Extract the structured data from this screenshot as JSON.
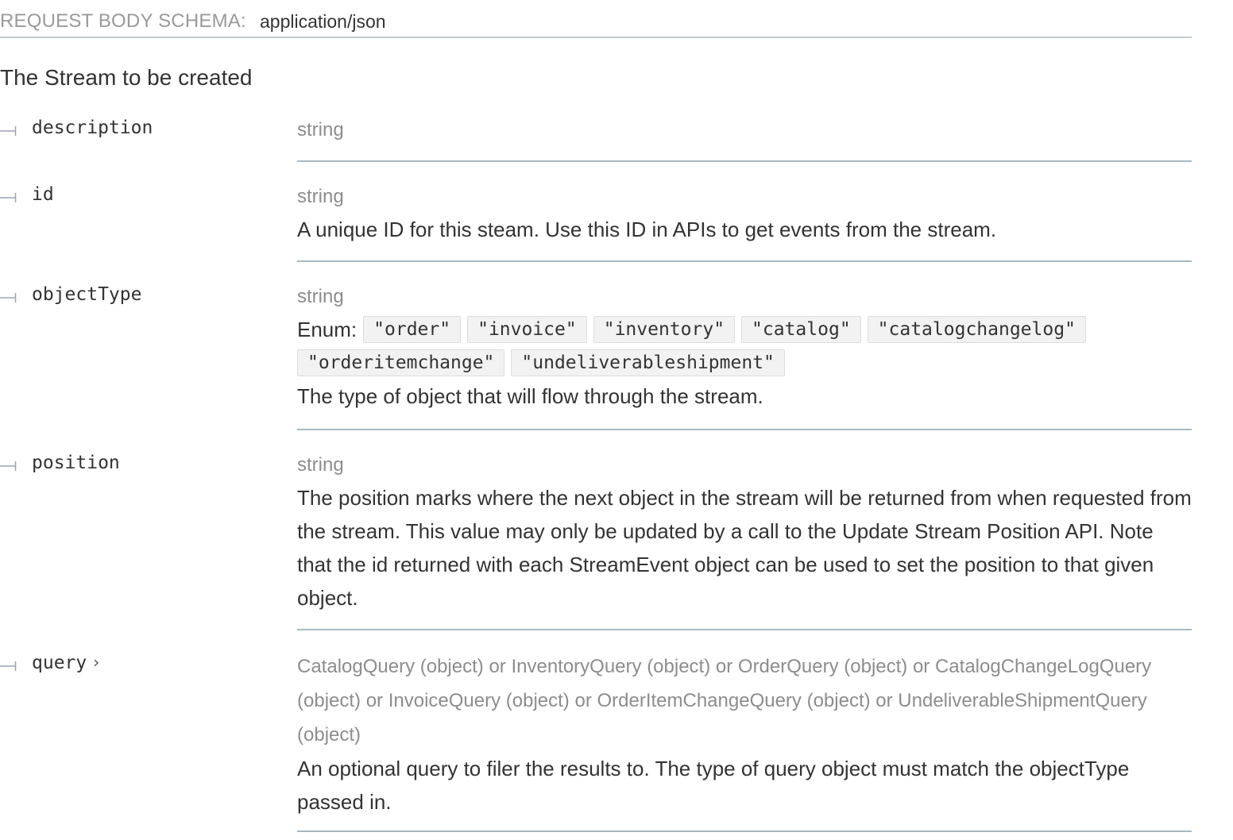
{
  "schema": {
    "label": "REQUEST BODY SCHEMA:",
    "content_type": "application/json",
    "description": "The Stream to be created"
  },
  "properties": [
    {
      "name": "description",
      "type": "string",
      "description": ""
    },
    {
      "name": "id",
      "type": "string",
      "description": "A unique ID for this steam. Use this ID in APIs to get events from the stream."
    },
    {
      "name": "objectType",
      "type": "string",
      "enum_label": "Enum:",
      "enum": [
        "\"order\"",
        "\"invoice\"",
        "\"inventory\"",
        "\"catalog\"",
        "\"catalogchangelog\"",
        "\"orderitemchange\"",
        "\"undeliverableshipment\""
      ],
      "description": "The type of object that will flow through the stream."
    },
    {
      "name": "position",
      "type": "string",
      "description": "The position marks where the next object in the stream will be returned from when requested from the stream. This value may only be updated by a call to the Update Stream Position API. Note that the id returned with each StreamEvent object can be used to set the position to that given object."
    },
    {
      "name": "query",
      "expandable": true,
      "type": "CatalogQuery (object) or InventoryQuery (object) or OrderQuery (object) or CatalogChangeLogQuery (object) or InvoiceQuery (object) or OrderItemChangeQuery (object) or UndeliverableShipmentQuery (object)",
      "description": "An optional query to filer the results to. The type of query object must match the objectType passed in."
    }
  ],
  "colors": {
    "muted_text": "#8d8d8d",
    "body_text": "#333333",
    "divider": "#a9b9c1",
    "chip_bg": "#f2f2f2"
  },
  "icons": {
    "tree_connector": "tree-branch-icon",
    "expand": "chevron-right-icon"
  }
}
